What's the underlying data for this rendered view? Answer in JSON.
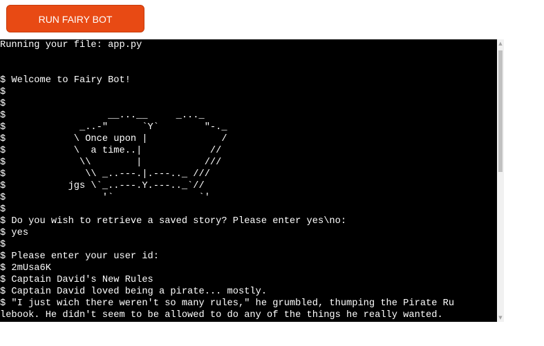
{
  "run_button": {
    "label": "RUN FAIRY BOT"
  },
  "terminal": {
    "lines": [
      "Running your file: app.py",
      "",
      "",
      "$ Welcome to Fairy Bot!",
      "$",
      "$",
      "$                  __...__     _..._",
      "$             _..-\"      `Y`        \"-._",
      "$            \\ Once upon |             /",
      "$            \\  a time..|            //",
      "$             \\\\        |           ///",
      "$              \\\\ _..---.|.---.._ ///",
      "$           jgs \\`_..---.Y.---.._`//",
      "$                 '`               `'",
      "$",
      "$ Do you wish to retrieve a saved story? Please enter yes\\no:",
      "$ yes",
      "$",
      "$ Please enter your user id:",
      "$ 2mUsa6K",
      "$ Captain David's New Rules",
      "$ Captain David loved being a pirate... mostly.",
      "$ \"I just wich there weren't so many rules,\" he grumbled, thumping the Pirate Ru",
      "lebook. He didn't seem to be allowed to do any of the things he really wanted."
    ]
  },
  "scrollbar": {
    "up_icon": "triangle-up",
    "down_icon": "triangle-down",
    "scroll_position": 0.0
  },
  "colors": {
    "button_bg": "#e84a14",
    "terminal_bg": "#000000",
    "terminal_text": "#ffffff"
  }
}
